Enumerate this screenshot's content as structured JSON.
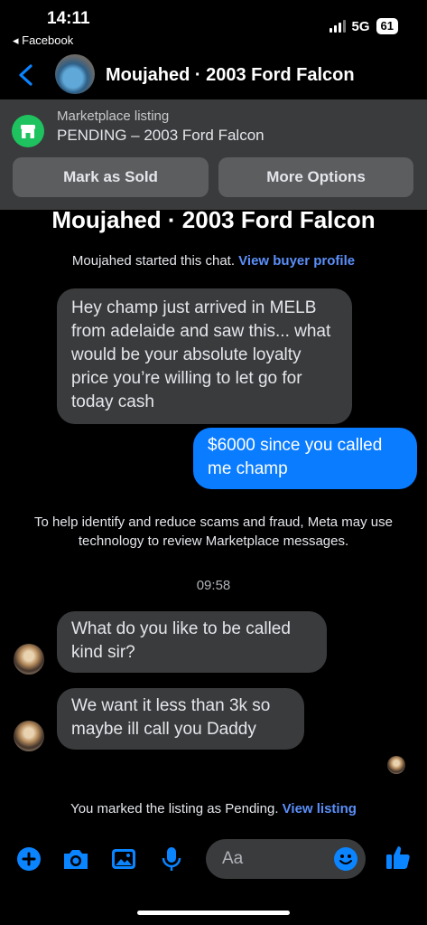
{
  "status_bar": {
    "time": "14:11",
    "back_app": "◂ Facebook",
    "network": "5G",
    "battery": "61"
  },
  "header": {
    "title": "Moujahed · 2003 Ford Falcon"
  },
  "listing_banner": {
    "subtitle": "Marketplace listing",
    "status_line": "PENDING – 2003 Ford Falcon",
    "mark_sold_label": "Mark as Sold",
    "more_options_label": "More Options"
  },
  "conversation": {
    "title": "Moujahed · 2003 Ford Falcon",
    "started_text": "Moujahed started this chat.",
    "buyer_profile_link": "View buyer profile",
    "safety_notice": "To help identify and reduce scams and fraud, Meta may use technology to review Marketplace messages.",
    "timestamp": "09:58",
    "pending_note": "You marked the listing as Pending.",
    "view_listing_link": "View listing"
  },
  "messages": [
    {
      "direction": "incoming",
      "text": "Hey champ just arrived in MELB from adelaide and saw this... what would be your absolute loyalty price you’re willing to let go for today cash"
    },
    {
      "direction": "outgoing",
      "text": "$6000 since you called me champ"
    },
    {
      "direction": "incoming",
      "text": "What do you like to be called kind sir?"
    },
    {
      "direction": "incoming",
      "text": "We want it less than 3k so maybe ill call you Daddy"
    }
  ],
  "composer": {
    "placeholder": "Aa",
    "icons": [
      "plus-icon",
      "camera-icon",
      "image-icon",
      "microphone-icon",
      "emoji-icon",
      "thumbs-up-icon"
    ],
    "accent_color": "#0a7cff"
  }
}
